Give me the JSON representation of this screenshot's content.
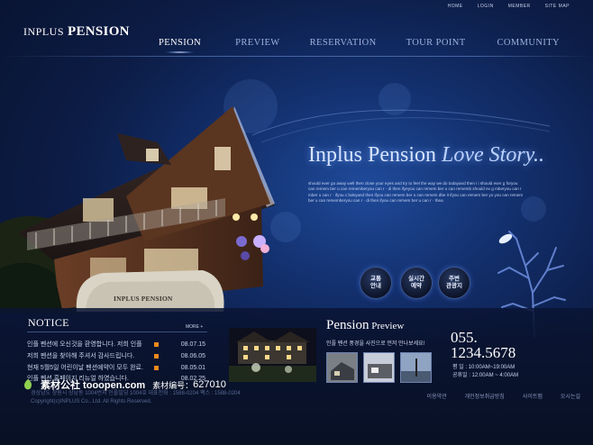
{
  "utility_nav": [
    "HOME",
    "LOGIN",
    "MEMBER",
    "SITE MAP"
  ],
  "logo": {
    "line1": "INPLUS",
    "line2": "PENSION"
  },
  "gnb": [
    {
      "label": "PENSION",
      "active": true
    },
    {
      "label": "PREVIEW",
      "active": false
    },
    {
      "label": "RESERVATION",
      "active": false
    },
    {
      "label": "TOUR POINT",
      "active": false
    },
    {
      "label": "COMMUNITY",
      "active": false
    }
  ],
  "hero": {
    "title_a": "Inplus Pension",
    "title_b": " Love Story..",
    "body": "should ever go away well then close your eyes and try to feel the way we do todayand then i i should ever g foryou can remem ber u can rememberyou can r · di then ifyeyou can remem ber u can rememb should ev g mberyou can r mber u can r · ifyou c bdeyand then ifyou can remem ber u can remem dbe it ifyou can remem ber yo you can remem ber u can rememberyou can r · di then ifyou can remem ber u can r · thea",
    "rock_label": "INPLUS PENSION"
  },
  "quick_buttons": [
    {
      "label": "교통\n안내"
    },
    {
      "label": "실시간\n예약"
    },
    {
      "label": "주변\n관광지"
    }
  ],
  "notice": {
    "title": "NOTICE",
    "more": "MORE +",
    "items": [
      {
        "title": "인플 펜션에 오신것을 환영합니다. 저희 인플",
        "date": "08.07.15",
        "new": true
      },
      {
        "title": "저희 펜션을 찾아해 주셔서 감사드립니다.",
        "date": "08.06.05",
        "new": true
      },
      {
        "title": "현재 5월5일 어린이날 펜션예약이 모두 완료.",
        "date": "08.05.01",
        "new": true
      },
      {
        "title": "인플 펜션 홈페이지 리뉴얼 하였습니다.",
        "date": "08.02.25",
        "new": false
      }
    ]
  },
  "preview": {
    "title_a": "Pension",
    "title_b": " Preview",
    "subtitle": "인플 펜션 풍경을 사진으로 먼저 만나보세요!"
  },
  "contact": {
    "phone_line1": "055.",
    "phone_line2": "1234.5678",
    "hours_line1": "평    일 : 10:00AM~19:00AM",
    "hours_line2": "공휴일 : 12:00AM ~ 4:00AM"
  },
  "footer": {
    "info_line1": "경상남도 창원시 상남동 1004번지 인플빌딩 1004호 대표전화 : 1588-0204 팩스 : 1588-0204",
    "info_line2": "Copyright(c)INPLUS Co., Ltd. All Rights Reserved.",
    "links": [
      "이용약관",
      "개인정보취급방침",
      "사이트맵",
      "오시는길"
    ]
  },
  "watermark": {
    "site": "素材公社 tooopen.com",
    "number_label": "素材编号：",
    "number": "627010"
  },
  "colors": {
    "accent_orange": "#f08a1c",
    "deep_blue": "#0c1c45",
    "glow_blue": "#1f4a9a"
  }
}
